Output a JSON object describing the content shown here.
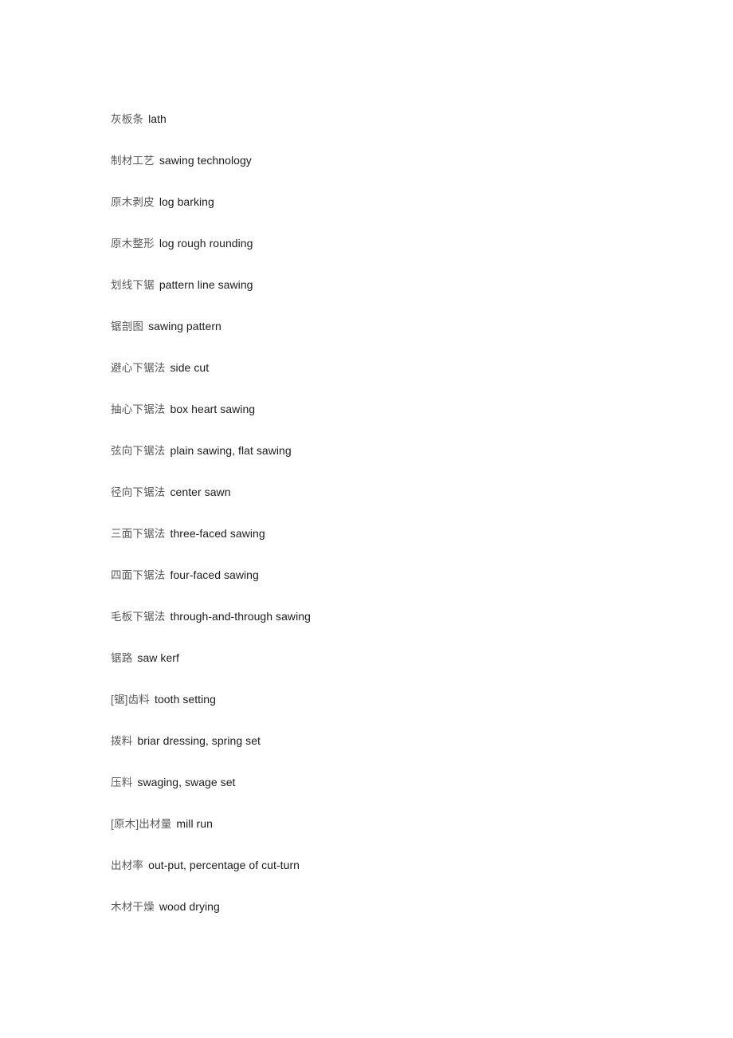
{
  "document": {
    "type": "glossary-list",
    "language_pair": "Chinese-English",
    "background_color": "#ffffff",
    "term_color": "#595959",
    "gloss_color": "#1c1c1c",
    "entries": [
      {
        "term": "灰板条",
        "gloss": "lath"
      },
      {
        "term": "制材工艺",
        "gloss": "sawing technology"
      },
      {
        "term": "原木剥皮",
        "gloss": "log barking"
      },
      {
        "term": "原木整形",
        "gloss": "log rough rounding"
      },
      {
        "term": "划线下锯",
        "gloss": "pattern line sawing"
      },
      {
        "term": "锯剖图",
        "gloss": "sawing pattern"
      },
      {
        "term": "避心下锯法",
        "gloss": "side cut"
      },
      {
        "term": "抽心下锯法",
        "gloss": "box heart sawing"
      },
      {
        "term": "弦向下锯法",
        "gloss": "plain sawing, flat sawing"
      },
      {
        "term": "径向下锯法",
        "gloss": "center sawn"
      },
      {
        "term": "三面下锯法",
        "gloss": "three-faced sawing"
      },
      {
        "term": "四面下锯法",
        "gloss": "four-faced sawing"
      },
      {
        "term": "毛板下锯法",
        "gloss": "through-and-through sawing"
      },
      {
        "term": "锯路",
        "gloss": "saw kerf"
      },
      {
        "term": "[锯]齿料",
        "gloss": "tooth setting"
      },
      {
        "term": "拨料",
        "gloss": "briar dressing, spring set"
      },
      {
        "term": "压料",
        "gloss": "swaging, swage set"
      },
      {
        "term": "[原木]出材量",
        "gloss": "mill run"
      },
      {
        "term": "出材率",
        "gloss": "out-put, percentage of cut-turn"
      },
      {
        "term": "木材干燥",
        "gloss": "wood drying"
      }
    ]
  }
}
